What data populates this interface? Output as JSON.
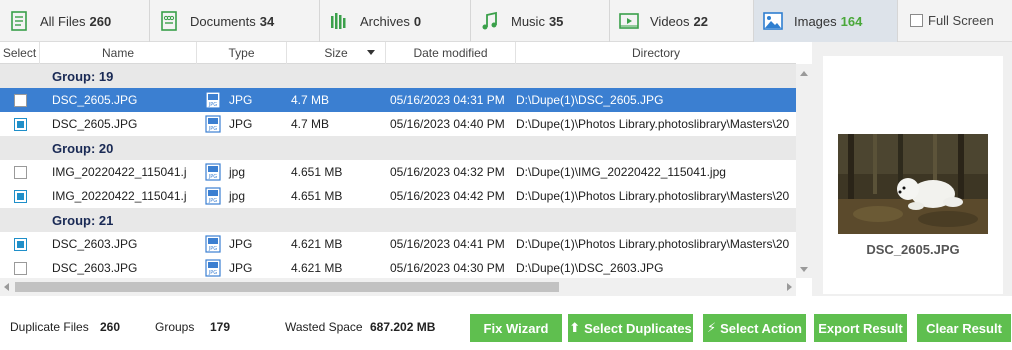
{
  "tabs": [
    {
      "label": "All Files",
      "count": "260",
      "icon": "all-files-icon"
    },
    {
      "label": "Documents",
      "count": "34",
      "icon": "documents-icon"
    },
    {
      "label": "Archives",
      "count": "0",
      "icon": "archives-icon"
    },
    {
      "label": "Music",
      "count": "35",
      "icon": "music-icon"
    },
    {
      "label": "Videos",
      "count": "22",
      "icon": "videos-icon"
    },
    {
      "label": "Images",
      "count": "164",
      "icon": "images-icon"
    }
  ],
  "active_tab": "Images",
  "fullscreen_label": "Full Screen",
  "columns": {
    "select": "Select",
    "name": "Name",
    "type": "Type",
    "size": "Size",
    "date": "Date modified",
    "directory": "Directory"
  },
  "rows": [
    {
      "kind": "group",
      "label": "Group: 19"
    },
    {
      "kind": "file",
      "checked": false,
      "selected": true,
      "name": "DSC_2605.JPG",
      "type": "JPG",
      "size": "4.7 MB",
      "date": "05/16/2023 04:31 PM",
      "dir": "D:\\Dupe(1)\\DSC_2605.JPG"
    },
    {
      "kind": "file",
      "checked": true,
      "selected": false,
      "name": "DSC_2605.JPG",
      "type": "JPG",
      "size": "4.7 MB",
      "date": "05/16/2023 04:40 PM",
      "dir": "D:\\Dupe(1)\\Photos Library.photoslibrary\\Masters\\20"
    },
    {
      "kind": "group",
      "label": "Group: 20"
    },
    {
      "kind": "file",
      "checked": false,
      "selected": false,
      "name": "IMG_20220422_115041.j",
      "type": "jpg",
      "size": "4.651 MB",
      "date": "05/16/2023 04:32 PM",
      "dir": "D:\\Dupe(1)\\IMG_20220422_115041.jpg"
    },
    {
      "kind": "file",
      "checked": true,
      "selected": false,
      "name": "IMG_20220422_115041.j",
      "type": "jpg",
      "size": "4.651 MB",
      "date": "05/16/2023 04:42 PM",
      "dir": "D:\\Dupe(1)\\Photos Library.photoslibrary\\Masters\\20"
    },
    {
      "kind": "group",
      "label": "Group: 21"
    },
    {
      "kind": "file",
      "checked": true,
      "selected": false,
      "name": "DSC_2603.JPG",
      "type": "JPG",
      "size": "4.621 MB",
      "date": "05/16/2023 04:41 PM",
      "dir": "D:\\Dupe(1)\\Photos Library.photoslibrary\\Masters\\20"
    },
    {
      "kind": "file",
      "checked": false,
      "selected": false,
      "name": "DSC_2603.JPG",
      "type": "JPG",
      "size": "4.621 MB",
      "date": "05/16/2023 04:30 PM",
      "dir": "D:\\Dupe(1)\\DSC_2603.JPG"
    }
  ],
  "preview": {
    "filename": "DSC_2605.JPG"
  },
  "stats": {
    "dup_label": "Duplicate Files",
    "dup_value": "260",
    "groups_label": "Groups",
    "groups_value": "179",
    "wasted_label": "Wasted Space",
    "wasted_value": "687.202 MB"
  },
  "buttons": {
    "fix_wizard": "Fix Wizard",
    "select_duplicates": "Select Duplicates",
    "select_action": "Select Action",
    "export_result": "Export Result",
    "clear_result": "Clear Result"
  },
  "colors": {
    "accent_green": "#5fbf4f",
    "selection_blue": "#3b7fd1",
    "checkbox_blue": "#1f8fc9",
    "count_green": "#4aa83a"
  }
}
